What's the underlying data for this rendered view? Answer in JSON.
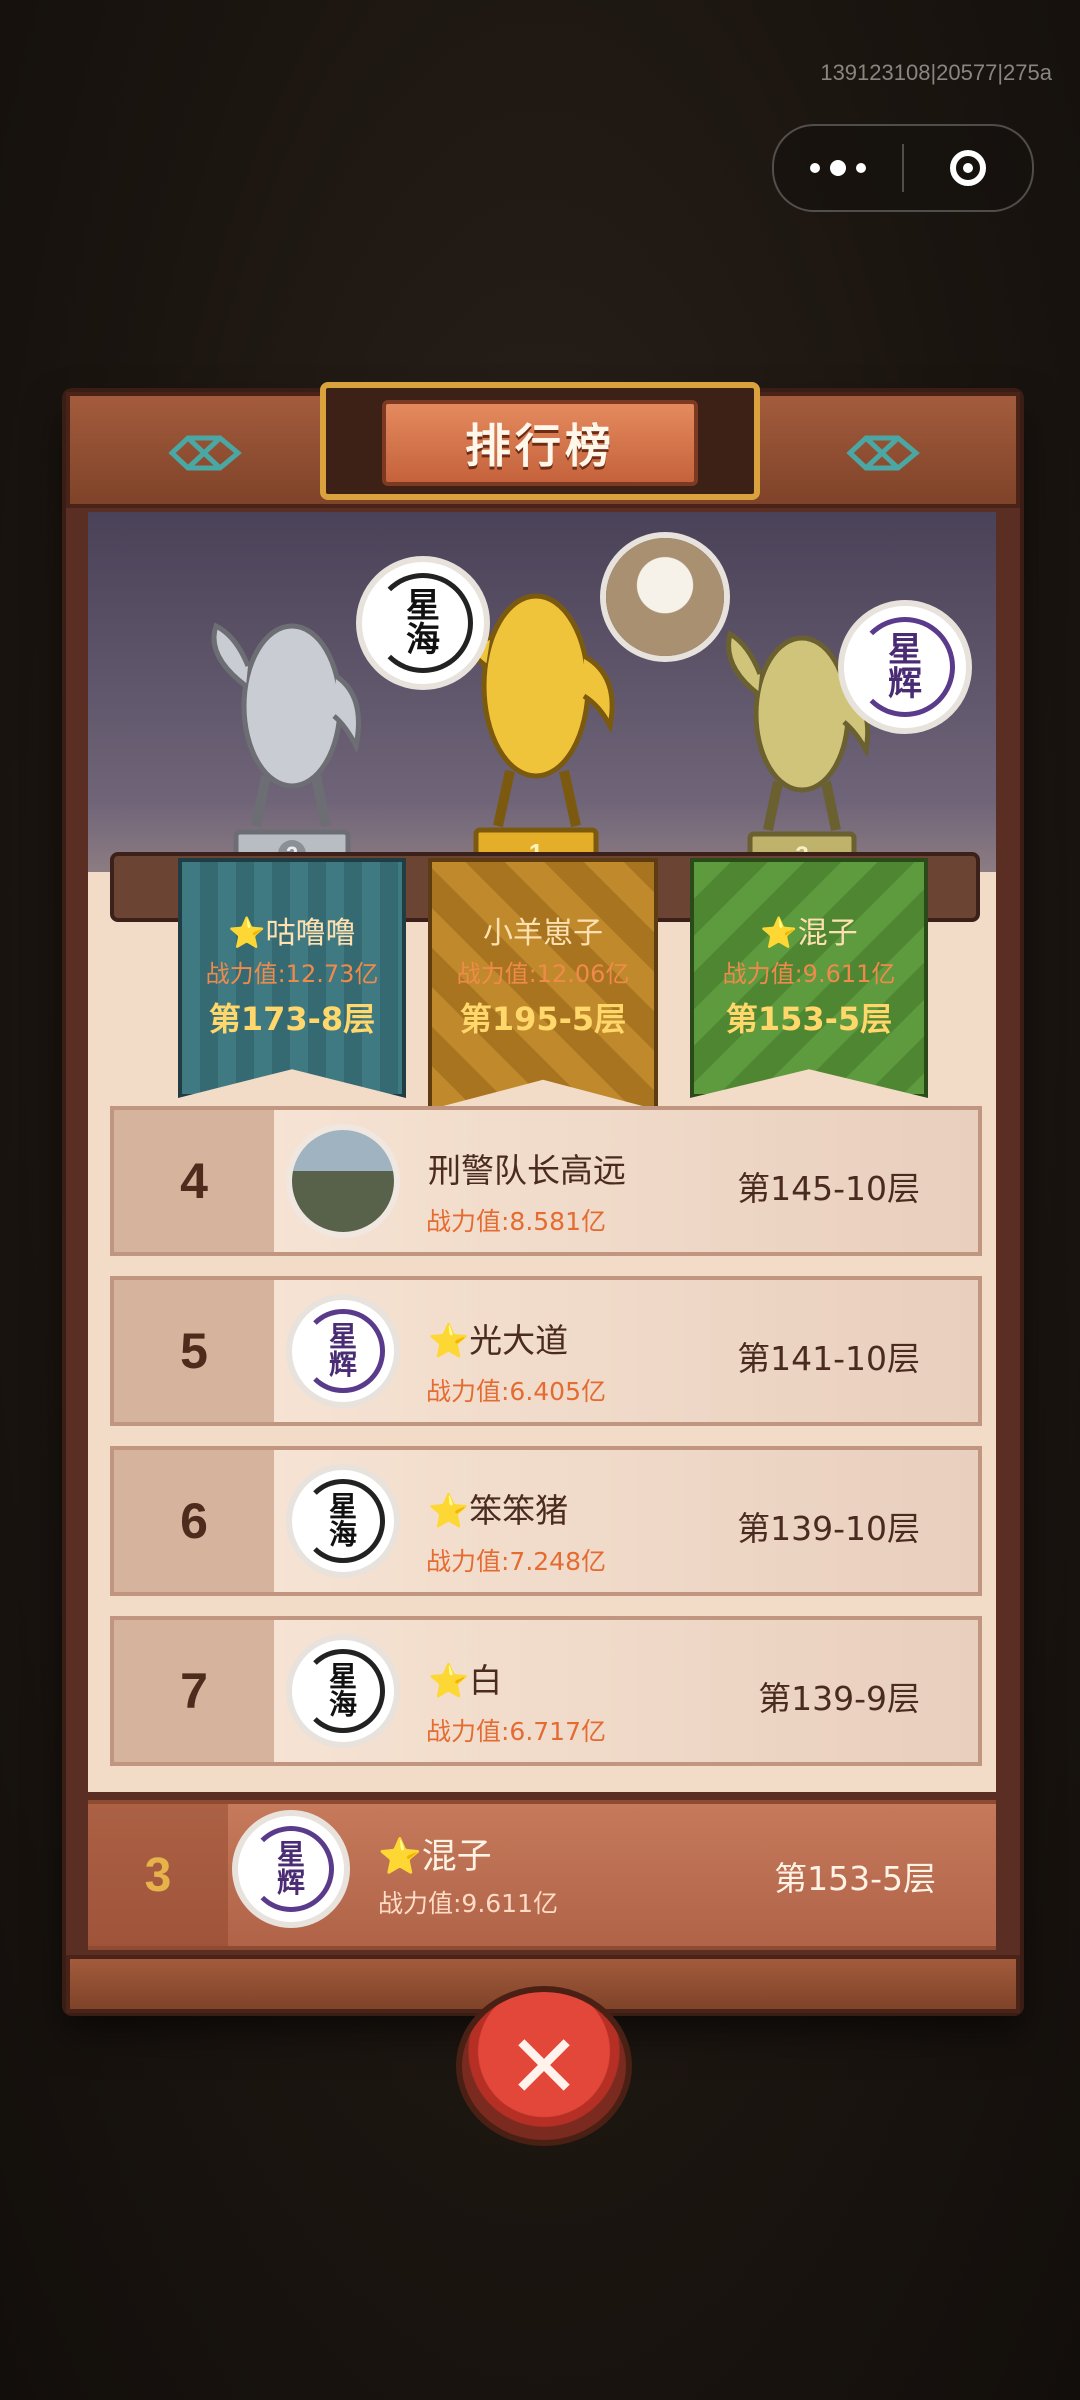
{
  "status_bar": {
    "build_id": "139123108|20577|275a"
  },
  "header": {
    "title": "排行榜"
  },
  "podium": [
    {
      "place_label": "2",
      "name": "⭐咕噜噜",
      "power": "战力值:12.73亿",
      "floor": "第173-8层",
      "avatar_text": "星海",
      "name_color": "#ffe0b0"
    },
    {
      "place_label": "1",
      "name": "小羊崽子",
      "power": "战力值:12.06亿",
      "floor": "第195-5层",
      "avatar_text": "",
      "name_color": "#ffe0b0"
    },
    {
      "place_label": "3",
      "name": "⭐混子",
      "power": "战力值:9.611亿",
      "floor": "第153-5层",
      "avatar_text": "星辉",
      "name_color": "#ffe0b0"
    }
  ],
  "rows": [
    {
      "rank": "4",
      "name": "刑警队长高远",
      "power": "战力值:8.581亿",
      "floor": "第145-10层",
      "avatar": "photo"
    },
    {
      "rank": "5",
      "name": "光大道",
      "starred": true,
      "power": "战力值:6.405亿",
      "floor": "第141-10层",
      "avatar_text": "星辉"
    },
    {
      "rank": "6",
      "name": "笨笨猪",
      "starred": true,
      "power": "战力值:7.248亿",
      "floor": "第139-10层",
      "avatar_text": "星海"
    },
    {
      "rank": "7",
      "name": "白",
      "starred": true,
      "power": "战力值:6.717亿",
      "floor": "第139-9层",
      "avatar_text": "星海"
    }
  ],
  "my_rank": {
    "rank": "3",
    "name": "混子",
    "power": "战力值:9.611亿",
    "floor": "第153-5层",
    "avatar_text": "星辉"
  },
  "icons": {
    "star": "⭐",
    "close": "✕"
  },
  "colors": {
    "gold": "#d9a23c",
    "accent_orange": "#e46c32",
    "frame": "#5a2e22"
  }
}
